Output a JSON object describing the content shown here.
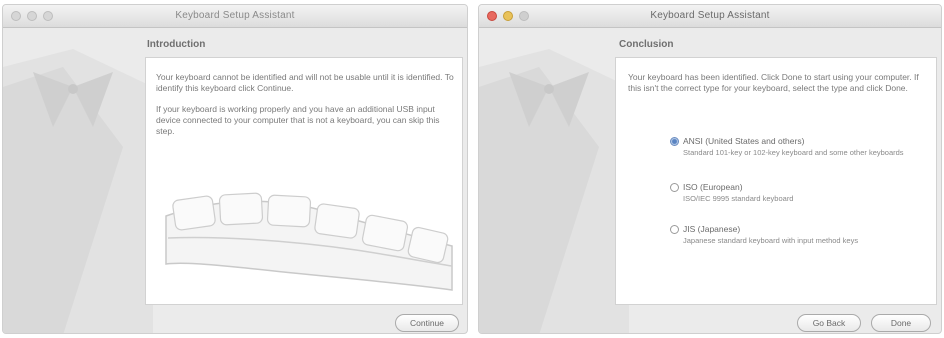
{
  "left_window": {
    "title": "Keyboard Setup Assistant",
    "heading": "Introduction",
    "paragraph1": "Your keyboard cannot be identified and will not be usable until it is identified. To identify this keyboard click Continue.",
    "paragraph2": "If your keyboard is working properly and you have an additional USB input device connected to your computer that is not a keyboard, you can skip this step.",
    "continue_label": "Continue"
  },
  "right_window": {
    "title": "Keyboard Setup Assistant",
    "heading": "Conclusion",
    "paragraph": "Your keyboard has been identified. Click Done to start using your computer. If this isn't the correct type for your keyboard, select the type and click Done.",
    "options": [
      {
        "label": "ANSI (United States and others)",
        "description": "Standard 101-key or 102-key keyboard and some other keyboards",
        "selected": true
      },
      {
        "label": "ISO (European)",
        "description": "ISO/IEC 9995 standard keyboard",
        "selected": false
      },
      {
        "label": "JIS (Japanese)",
        "description": "Japanese standard keyboard with input method keys",
        "selected": false
      }
    ],
    "go_back_label": "Go Back",
    "done_label": "Done"
  },
  "colors": {
    "window_bg": "#ebebeb",
    "panel_bg": "#ffffff",
    "text": "#7a7a7a",
    "close_light": "#e8695f",
    "minimize_light": "#e9c25a",
    "radio_selected": "#5a84c2"
  }
}
